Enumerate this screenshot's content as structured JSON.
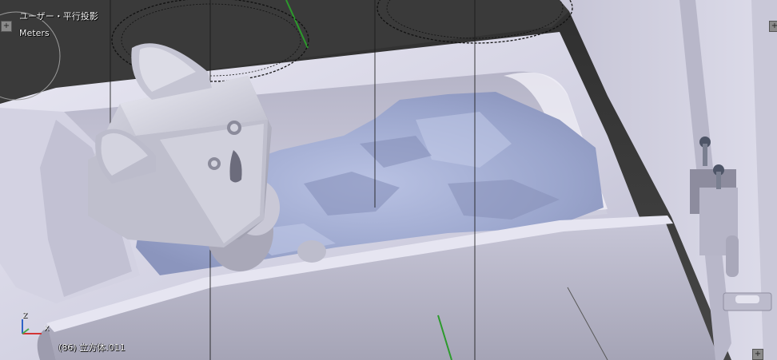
{
  "viewport": {
    "view_name": "ユーザー・平行投影",
    "units": "Meters",
    "object_info": "(86) 立方体.011"
  },
  "axis_widget": {
    "z_label": "Z",
    "x_label": "X",
    "colors": {
      "x": "#d23434",
      "y": "#49a949",
      "z": "#2f63c8"
    }
  },
  "corner_widgets": {
    "symbol": "+"
  },
  "scene": {
    "background": "#3d3d3d",
    "bath_color": "#d8d7e5",
    "water_color": "#a9b3d6",
    "cube_color": "#c7c7d3",
    "grid_color": "#707070",
    "green_axis": "#2c9a2c"
  }
}
